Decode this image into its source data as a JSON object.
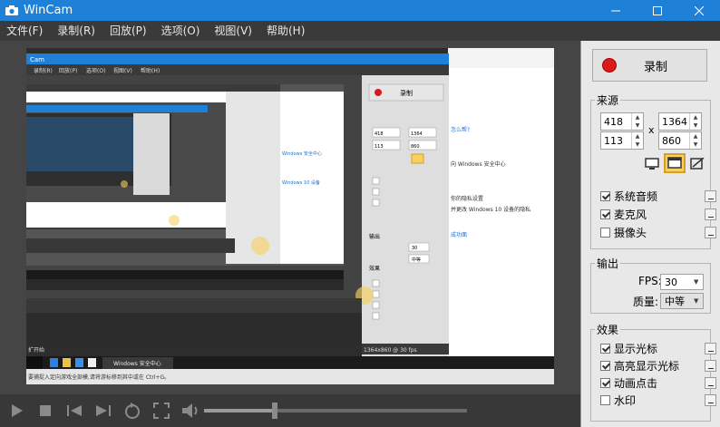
{
  "window": {
    "title": "WinCam",
    "minimize_glyph": "minimize-icon",
    "maximize_glyph": "maximize-icon",
    "close_glyph": "close-icon"
  },
  "menu": {
    "items": [
      "文件(F)",
      "录制(R)",
      "回放(P)",
      "选项(O)",
      "视图(V)",
      "帮助(H)"
    ]
  },
  "record": {
    "label": "录制",
    "color": "#d91b1b"
  },
  "source": {
    "title": "来源",
    "x": "418",
    "y": "113",
    "width": "1364",
    "height": "860",
    "x_sep": "x",
    "modes": [
      "fullscreen-icon",
      "window-icon",
      "region-icon"
    ],
    "selected_mode": "window-icon",
    "options": [
      {
        "label": "系统音频",
        "checked": true
      },
      {
        "label": "麦克风",
        "checked": true
      },
      {
        "label": "摄像头",
        "checked": false
      }
    ]
  },
  "output": {
    "title": "输出",
    "fps_label": "FPS:",
    "fps_value": "30",
    "quality_label": "质量:",
    "quality_value": "中等"
  },
  "effects": {
    "title": "效果",
    "options": [
      {
        "label": "显示光标",
        "checked": true
      },
      {
        "label": "高亮显示光标",
        "checked": true
      },
      {
        "label": "动画点击",
        "checked": true
      },
      {
        "label": "水印",
        "checked": false
      }
    ]
  },
  "playback": {
    "icons": [
      "play-icon",
      "stop-icon",
      "previous-icon",
      "next-icon",
      "loop-icon",
      "fullscreen-icon",
      "volume-icon"
    ],
    "volume_level": 0.27
  },
  "preview": {
    "status": "1364x860 @ 30 fps",
    "taskbar_window": "Windows 安全中心",
    "capture_menu": [
      "录制(R)",
      "回放(P)",
      "选项(O)",
      "视图(V)",
      "帮助(H)"
    ],
    "side_texts": [
      "怎么帮?",
      "向 Windows 安全中心",
      "你的隐私设置",
      "并更改 Windows 10 设备的隐私",
      "成功面"
    ],
    "hint": "要捕捉入定向游戏全部模,请将游标移到其中或在 Ctrl+G。",
    "capture_output_title": "输出",
    "capture_effects_title": "效果",
    "capture_fps": "30",
    "capture_quality": "中等",
    "capture_record_label": "录制",
    "start_label": "扩开始",
    "spin_values": [
      "418",
      "1364",
      "113",
      "860"
    ]
  },
  "colors": {
    "titlebar": "#1f80d8",
    "menubar": "#3a3a3a",
    "panel": "#e8e8e8",
    "highlight": "#f6d060"
  }
}
